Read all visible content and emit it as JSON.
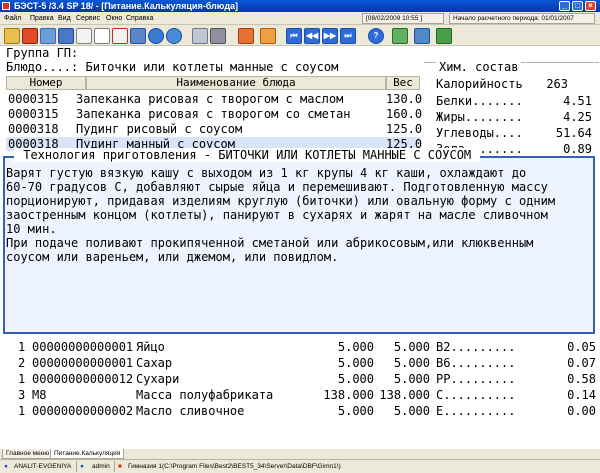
{
  "window": {
    "title": "БЭСТ-5 /3.4 SP 18/ - [Питание.Калькуляция-блюда]",
    "minimize": "_",
    "maximize": "□",
    "close": "×"
  },
  "menu": {
    "items": [
      "Файл",
      "Правка",
      "Вид",
      "Сервис",
      "Окно",
      "Справка"
    ],
    "date": "[08/02/2009 10:55 ]",
    "period": "Начало расчетного периода: 01/01/2007"
  },
  "toolbar": {
    "icons": [
      "folder-icon",
      "calendar-icon",
      "print-preview-icon",
      "printer-icon",
      "save-icon",
      "new-document-icon",
      "delete-icon",
      "edit-icon",
      "search-icon",
      "filter-icon",
      "sort-icon",
      "dropdown-icon",
      "arrows-icon",
      "refresh-icon",
      "first-record-icon",
      "prev-page-icon",
      "next-page-icon",
      "last-record-icon",
      "help-icon",
      "chart-icon",
      "report-icon",
      "settings-icon"
    ],
    "nav": [
      "⏮",
      "◀◀",
      "▶▶",
      "⏭",
      "?"
    ]
  },
  "main": {
    "group_label": "Группа ГП:",
    "dish_line": "Блюдо....: Биточки или котлеты манные с соусом",
    "columns": {
      "number": "Номер",
      "name": "Наименование блюда",
      "weight": "Вес"
    },
    "rows": [
      {
        "number": "0000315",
        "name": "Запеканка рисовая с творогом с маслом",
        "weight": "130.0"
      },
      {
        "number": "0000315",
        "name": "Запеканка рисовая с творогом со сметан",
        "weight": "160.0"
      },
      {
        "number": "0000318",
        "name": "Пудинг рисовый с соусом",
        "weight": "125.0"
      },
      {
        "number": "0000318",
        "name": "Пудинг манный с соусом",
        "weight": "125.0"
      }
    ]
  },
  "chem": {
    "title": "Хим. состав",
    "items": [
      {
        "label": "Калорийность",
        "value": "263"
      },
      {
        "label": "Белки.......",
        "value": "4.51"
      },
      {
        "label": "Жиры........",
        "value": "4.25"
      },
      {
        "label": "Углеводы....",
        "value": "51.64"
      },
      {
        "label": "Зола........",
        "value": "0.89"
      }
    ]
  },
  "tech": {
    "title": " Технология приготовления - БИТОЧКИ ИЛИ КОТЛЕТЫ МАННЫЕ С СОУСОМ ",
    "lines": [
      "Варят густую вязкую кашу с выходом из 1 кг крупы 4 кг каши, охлаждают до",
      "60-70 градусов С, добавляют сырые яйца и перемешивают. Подготовленную массу",
      "порционируют, придавая изделиям круглую (биточки) или овальную форму с одним",
      "заостренным концом (котлеты), панируют в сухарях и жарят на масле сливочном",
      "10 мин.",
      "При подаче поливают прокипяченной сметаной или абрикосовым,или клюквенным",
      "соусом или вареньем, или джемом, или повидлом."
    ]
  },
  "ingredients": [
    {
      "n": "1",
      "code": "00000000000001",
      "name": "Яйцо",
      "q1": "5.000",
      "q2": "5.000",
      "nut": "В2.........",
      "val": "0.05"
    },
    {
      "n": "2",
      "code": "00000000000001",
      "name": "Сахар",
      "q1": "5.000",
      "q2": "5.000",
      "nut": "В6.........",
      "val": "0.07"
    },
    {
      "n": "1",
      "code": "00000000000012",
      "name": "Сухари",
      "q1": "5.000",
      "q2": "5.000",
      "nut": "РР.........",
      "val": "0.58"
    },
    {
      "n": "3",
      "code": "М8",
      "name": "Масса полуфабриката",
      "q1": "138.000",
      "q2": "138.000",
      "nut": "С..........",
      "val": "0.14"
    },
    {
      "n": "1",
      "code": "00000000000002",
      "name": "Масло сливочное",
      "q1": "5.000",
      "q2": "5.000",
      "nut": "Е..........",
      "val": "0.00"
    }
  ],
  "tabs": {
    "main_menu": "Главное меню",
    "calc": "Питание.Калькуляция"
  },
  "status": {
    "user": "ANALIT-EVGENIYA",
    "role": "admin",
    "path": "Гимназия 1(C:\\Program Files\\Best2\\BEST5_34\\Server\\Data\\DBF\\Gimn1\\)"
  },
  "colors": {
    "titlebar": "#0a58d8",
    "selection": "#d8e4f8",
    "tech_bg": "#eef4ff",
    "tech_border": "#3a5fb0"
  }
}
